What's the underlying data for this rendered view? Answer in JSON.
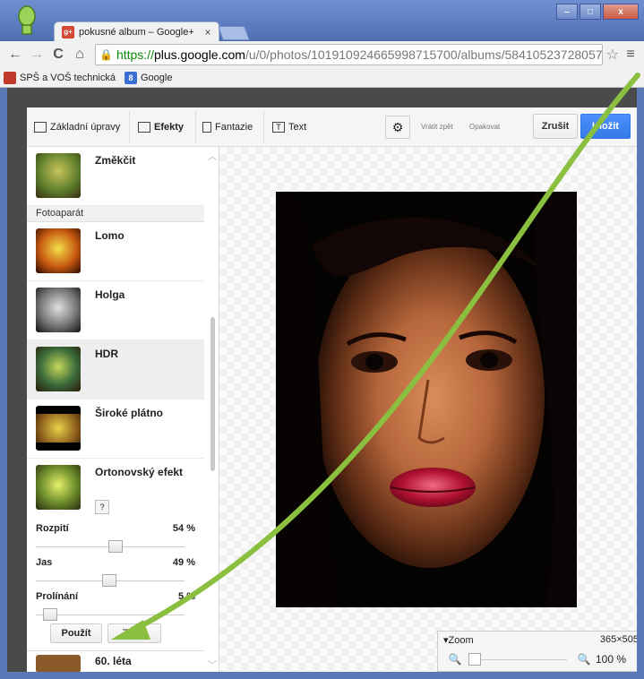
{
  "browser": {
    "tab_title": "pokusné album – Google+",
    "tab_close": "×",
    "url_scheme": "https://",
    "url_host": "plus.google.com",
    "url_path": "/u/0/photos/101910924665998715700/albums/58410523728057",
    "win_minimize": "–",
    "win_maximize": "□",
    "win_close": "x",
    "nav_back": "←",
    "nav_forward": "→",
    "nav_reload": "C",
    "nav_home": "⌂",
    "star": "☆",
    "menu": "≡",
    "bookmarks": [
      {
        "label": "SPŠ a VOŠ technická",
        "color": "#c0392b"
      },
      {
        "label": "Google",
        "color": "#3b6fd6"
      }
    ]
  },
  "toolbar": {
    "basic": "Základní úpravy",
    "effects": "Efekty",
    "fantasy": "Fantazie",
    "text": "Text",
    "gear": "⚙",
    "undo": "Vrátit zpět",
    "redo": "Opakovat",
    "cancel": "Zrušit",
    "save": "Uložit"
  },
  "panel": {
    "section_camera": "Fotoaparát",
    "items": [
      {
        "label": "Změkčit"
      },
      {
        "label": "Lomo"
      },
      {
        "label": "Holga"
      },
      {
        "label": "HDR"
      },
      {
        "label": "Široké plátno"
      },
      {
        "label": "Ortonovský efekt"
      }
    ],
    "help": "?",
    "sliders": [
      {
        "label": "Rozpití",
        "value": "54 %",
        "level": 0.54
      },
      {
        "label": "Jas",
        "value": "49 %",
        "level": 0.49
      },
      {
        "label": "Prolínání",
        "value": "5 %",
        "level": 0.05
      }
    ],
    "apply": "Použít",
    "discard": "Zrušit",
    "next_item": "60. léta"
  },
  "canvas": {
    "zoom_label": "▾Zoom",
    "dimensions": "365×505",
    "zoom_out": "🔍",
    "zoom_in": "🔍",
    "zoom_value": "100 %"
  },
  "colors": {
    "save_button": "#4d90fe",
    "arrow": "#8bbf3f"
  }
}
